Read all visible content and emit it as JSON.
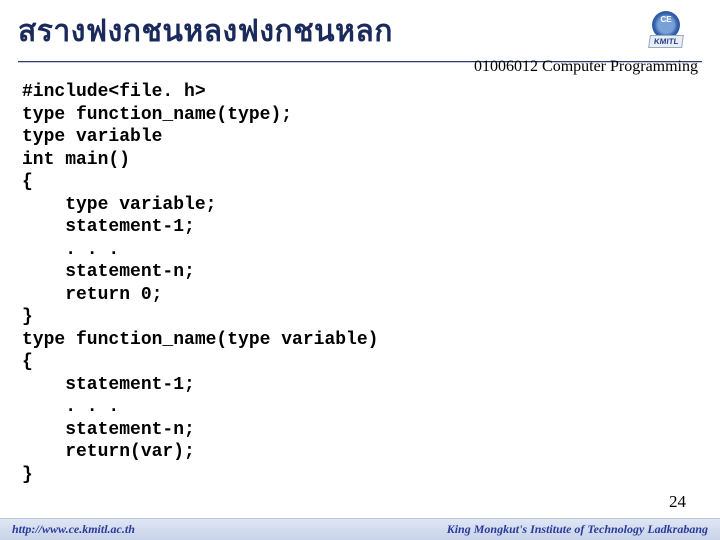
{
  "header": {
    "title": "สรางฟงกชนหลงฟงกชนหลก",
    "course_label": "01006012 Computer Programming",
    "logo_text": "KMITL"
  },
  "code": "#include<file. h>\ntype function_name(type);\ntype variable\nint main()\n{\n    type variable;\n    statement-1;\n    . . .\n    statement-n;\n    return 0;\n}\ntype function_name(type variable)\n{\n    statement-1;\n    . . .\n    statement-n;\n    return(var);\n}",
  "page_number": "24",
  "footer": {
    "left": "http://www.ce.kmitl.ac.th",
    "right": "King Mongkut's Institute of Technology Ladkrabang"
  }
}
